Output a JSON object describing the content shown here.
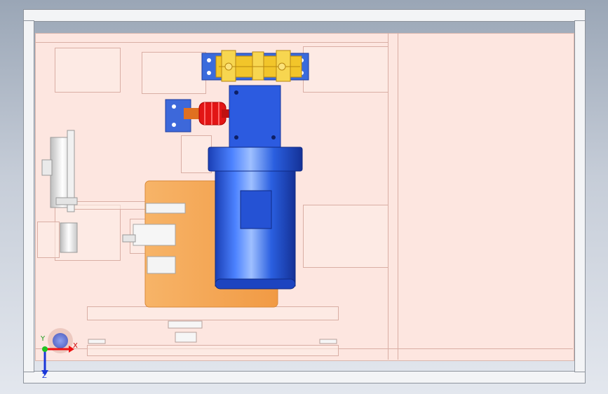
{
  "viewer": {
    "axes": {
      "x_label": "X",
      "y_label": "Y",
      "z_label": "Z"
    },
    "colors": {
      "background_top": "#9aa6b6",
      "frame": "#f3f4f6",
      "panel": "#fde6e0",
      "ghost_outline": "#d9aea4",
      "motor_blue": "#2a5fe0",
      "gear_yellow": "#f2c52a",
      "flange_blue": "#3a6bdc",
      "spring_red": "#e21515",
      "base_orange": "#f5a85c"
    },
    "components": [
      {
        "name": "electric-motor",
        "icon": "motor-icon"
      },
      {
        "name": "gearbox",
        "icon": "gearbox-icon"
      },
      {
        "name": "linkage-mechanism",
        "icon": "linkage-icon"
      },
      {
        "name": "coupling-spring",
        "icon": "spring-icon"
      },
      {
        "name": "bearing-flange",
        "icon": "flange-icon"
      },
      {
        "name": "mounting-base-plate",
        "icon": "plate-icon"
      },
      {
        "name": "pulley-assembly",
        "icon": "pulley-icon"
      }
    ]
  }
}
